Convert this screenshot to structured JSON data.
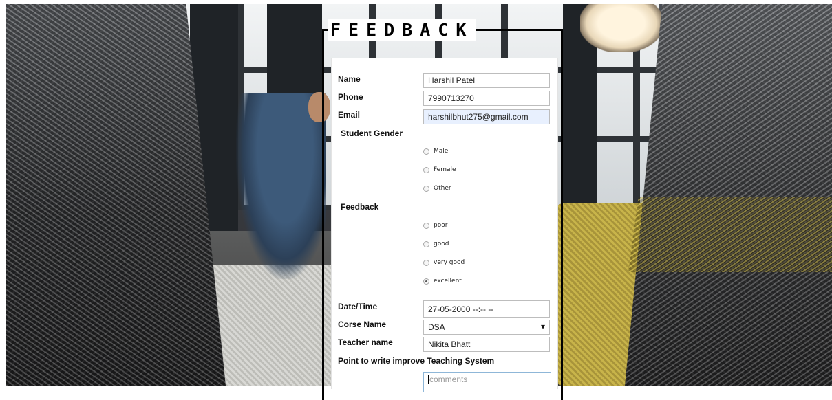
{
  "form": {
    "legend": "FEEDBACK",
    "fields": {
      "name": {
        "label": "Name",
        "value": "Harshil Patel"
      },
      "phone": {
        "label": "Phone",
        "value": "7990713270"
      },
      "email": {
        "label": "Email",
        "value": "harshilbhut275@gmail.com"
      }
    },
    "gender": {
      "label": "Student Gender",
      "options": [
        "Male",
        "Female",
        "Other"
      ],
      "selected": null
    },
    "feedback": {
      "label": "Feedback",
      "options": [
        "poor",
        "good",
        "very good",
        "excellent"
      ],
      "selected": "excellent"
    },
    "datetime": {
      "label": "Date/Time",
      "value": "27-05-2000 --:-- --"
    },
    "course": {
      "label": "Corse Name",
      "value": "DSA"
    },
    "teacher": {
      "label": "Teacher name",
      "value": "Nikita Bhatt"
    },
    "improve": {
      "label": "Point to write improve Teaching System",
      "placeholder": "comments"
    }
  }
}
